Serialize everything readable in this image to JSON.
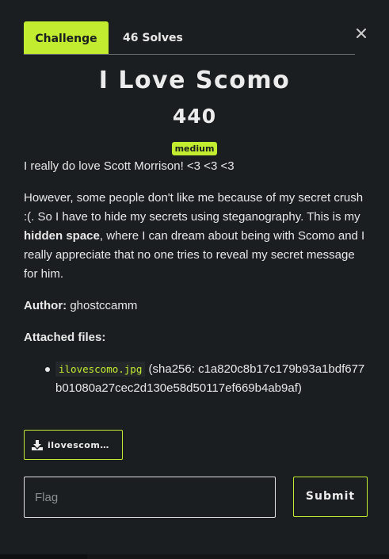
{
  "tabs": {
    "challenge": "Challenge",
    "solves": "46 Solves"
  },
  "close_icon": "close-icon",
  "challenge": {
    "name": "I Love Scomo",
    "points": "440",
    "difficulty": "medium"
  },
  "description": {
    "line1": "I really do love Scott Morrison! <3 <3 <3",
    "p2_part1": "However, some people don't like me because of my secret crush :(. So I have to hide my secrets using steganography. This is my ",
    "p2_bold": "hidden space",
    "p2_part2": ", where I can dream about being with Scomo and I really appreciate that no one tries to reveal my secret message for him."
  },
  "author": {
    "label": "Author:",
    "value": "ghostccamm"
  },
  "attachments": {
    "label": "Attached files:",
    "files": [
      {
        "name": "ilovescomo.jpg",
        "hash_text": "(sha256: c1a820c8b17c179b93a1bdf677b01080a27cec2d130e58d50117ef669b4ab9af)"
      }
    ],
    "download_label": "ilovescomo.jpg",
    "download_icon": "download-icon"
  },
  "flag_form": {
    "placeholder": "Flag",
    "submit_label": "Submit"
  },
  "colors": {
    "accent": "#c2ec2f",
    "background": "#1b1e20",
    "text": "#e8e8e8"
  }
}
